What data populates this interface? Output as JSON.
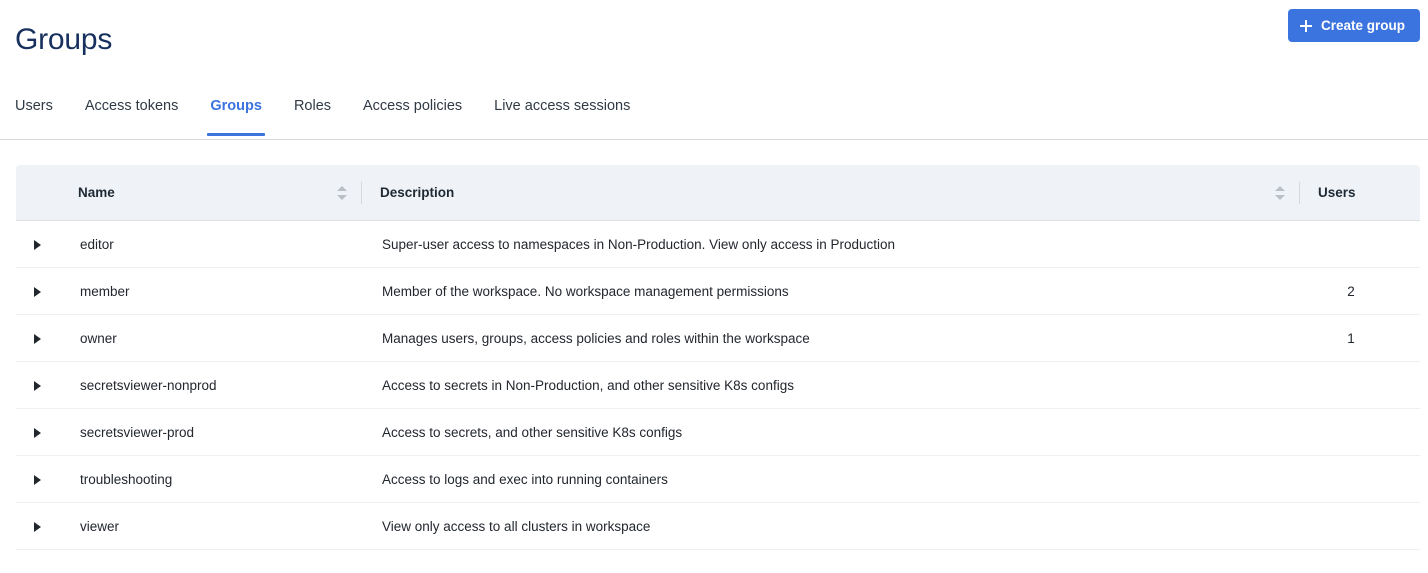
{
  "header": {
    "title": "Groups",
    "create_button": {
      "label": "Create group",
      "icon": "plus-icon"
    },
    "accent_color": "#3b73df",
    "title_color": "#17305e"
  },
  "tabs": [
    {
      "label": "Users",
      "active": false
    },
    {
      "label": "Access tokens",
      "active": false
    },
    {
      "label": "Groups",
      "active": true
    },
    {
      "label": "Roles",
      "active": false
    },
    {
      "label": "Access policies",
      "active": false
    },
    {
      "label": "Live access sessions",
      "active": false
    }
  ],
  "table": {
    "columns": [
      {
        "key": "toggle",
        "label": "",
        "sortable": false
      },
      {
        "key": "name",
        "label": "Name",
        "sortable": true
      },
      {
        "key": "description",
        "label": "Description",
        "sortable": true
      },
      {
        "key": "users",
        "label": "Users",
        "sortable": false
      }
    ],
    "rows": [
      {
        "name": "editor",
        "description": "Super-user access to namespaces in Non-Production. View only access in Production",
        "users": ""
      },
      {
        "name": "member",
        "description": "Member of the workspace. No workspace management permissions",
        "users": "2"
      },
      {
        "name": "owner",
        "description": "Manages users, groups, access policies and roles within the workspace",
        "users": "1"
      },
      {
        "name": "secretsviewer-nonprod",
        "description": "Access to secrets in Non-Production, and other sensitive K8s configs",
        "users": ""
      },
      {
        "name": "secretsviewer-prod",
        "description": "Access to secrets, and other sensitive K8s configs",
        "users": ""
      },
      {
        "name": "troubleshooting",
        "description": "Access to logs and exec into running containers",
        "users": ""
      },
      {
        "name": "viewer",
        "description": "View only access to all clusters in workspace",
        "users": ""
      }
    ]
  }
}
